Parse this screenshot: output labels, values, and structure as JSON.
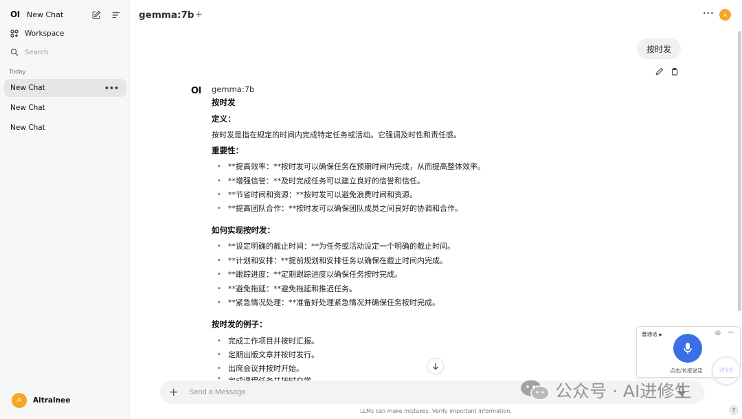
{
  "sidebar": {
    "logo": "OI",
    "new_chat_label": "New Chat",
    "workspace_label": "Workspace",
    "search_placeholder": "Search",
    "section_today": "Today",
    "chats": [
      "New Chat",
      "New Chat",
      "New Chat"
    ],
    "active_chat_menu": "•••",
    "user": {
      "initial": "A",
      "name": "Aitrainee"
    }
  },
  "header": {
    "model": "gemma:7b",
    "add_model": "+",
    "menu": "···",
    "avatar_initial": "A"
  },
  "conversation": {
    "user_message": "按时发",
    "assistant": {
      "logo": "OI",
      "model": "gemma:7b",
      "title": "按时发",
      "sec1_heading": "定义：",
      "sec1_text": "按时发是指在规定的时间内完成特定任务或活动。它强调及时性和责任感。",
      "sec2_heading": "重要性：",
      "sec2_items": [
        "**提高效率：**按时发可以确保任务在预期时间内完成，从而提高整体效率。",
        "**增强信誉：**及时完成任务可以建立良好的信誉和信任。",
        "**节省时间和资源：**按时发可以避免浪费时间和资源。",
        "**提高团队合作：**按时发可以确保团队成员之间良好的协调和合作。"
      ],
      "sec3_heading": "如何实现按时发：",
      "sec3_items": [
        "**设定明确的截止时间：**为任务或活动设定一个明确的截止时间。",
        "**计划和安排：**提前规划和安排任务以确保在截止时间内完成。",
        "**跟踪进度：**定期跟踪进度以确保任务按时完成。",
        "**避免拖延：**避免拖延和推迟任务。",
        "**紧急情况处理：**准备好处理紧急情况并确保任务按时完成。"
      ],
      "sec4_heading": "按时发的例子：",
      "sec4_items": [
        "完成工作项目并按时汇报。",
        "定期出版文章并按时发行。",
        "出席会议并按时开始。",
        "完成课程任务并按时交学"
      ]
    }
  },
  "input": {
    "placeholder": "Send a Message",
    "value": "",
    "add_label": "+"
  },
  "footer_note": "LLMs can make mistakes. Verify important information.",
  "help_label": "?",
  "voice_widget": {
    "language": "普通话",
    "hint": "点击/长按说话",
    "brand": "iFLY"
  },
  "watermark": "公众号 · AI进修生",
  "colors": {
    "accent_avatar": "#f5a623",
    "voice_button": "#3b6fe8",
    "sidebar_bg": "#f7f7f7",
    "bubble_bg": "#f0f0f0"
  }
}
